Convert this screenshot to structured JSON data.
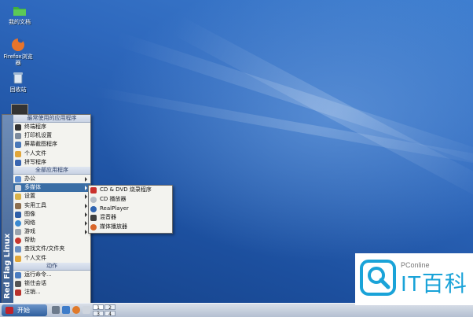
{
  "desktop": {
    "icons": [
      {
        "label": "我的文档"
      },
      {
        "label": "Firefox浏览器"
      },
      {
        "label": "回收站"
      }
    ]
  },
  "start_menu": {
    "banner": "Red Flag Linux",
    "recent_header": "最常使用的应用程序",
    "recent": [
      "终端程序",
      "打印机设置",
      "屏幕截图程序",
      "个人文件",
      "拼写程序"
    ],
    "all_header": "全部应用程序",
    "all": [
      {
        "label": "办公",
        "submenu": true
      },
      {
        "label": "多媒体",
        "submenu": true,
        "active": true
      },
      {
        "label": "设置",
        "submenu": true
      },
      {
        "label": "实用工具",
        "submenu": true
      },
      {
        "label": "图像",
        "submenu": true
      },
      {
        "label": "网络",
        "submenu": true
      },
      {
        "label": "游戏",
        "submenu": true
      },
      {
        "label": "帮助",
        "submenu": false
      },
      {
        "label": "查找文件/文件夹",
        "submenu": false
      },
      {
        "label": "个人文件",
        "submenu": false
      }
    ],
    "actions_header": "动作",
    "actions": [
      "运行命令...",
      "锁住会话",
      "注销..."
    ]
  },
  "submenu": {
    "items": [
      "CD & DVD 烧录程序",
      "CD 播放器",
      "RealPlayer",
      "混音器",
      "媒体播放器"
    ]
  },
  "taskbar": {
    "start_label": "开始",
    "pager": [
      "1",
      "2",
      "3",
      "4"
    ]
  },
  "watermark": {
    "brand": "PConline",
    "name": "IT百科"
  }
}
